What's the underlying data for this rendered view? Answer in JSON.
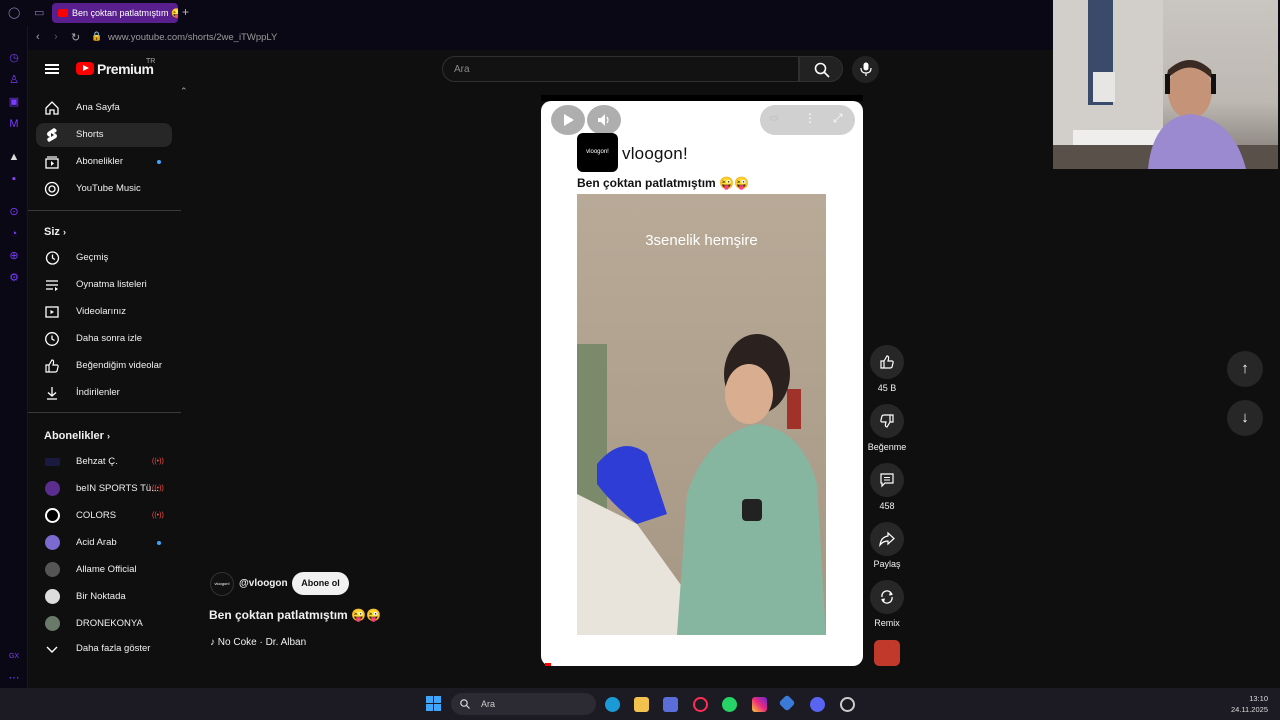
{
  "browser": {
    "tab_title": "Ben çoktan patlatmıştım 😜",
    "new_tab": "+",
    "url": "www.youtube.com/shorts/2we_iTWppLY",
    "sidebar_bottom": "GX"
  },
  "header": {
    "logo_text": "Premium",
    "logo_region": "TR",
    "search_placeholder": "Ara"
  },
  "sidebar": {
    "main": [
      {
        "label": "Ana Sayfa",
        "icon": "home-icon"
      },
      {
        "label": "Shorts",
        "icon": "shorts-icon",
        "active": true
      },
      {
        "label": "Abonelikler",
        "icon": "subscriptions-icon"
      },
      {
        "label": "YouTube Music",
        "icon": "youtube-music-icon"
      }
    ],
    "you_heading": "Siz",
    "you": [
      {
        "label": "Geçmiş",
        "icon": "history-icon"
      },
      {
        "label": "Oynatma listeleri",
        "icon": "playlist-icon"
      },
      {
        "label": "Videolarınız",
        "icon": "your-videos-icon"
      },
      {
        "label": "Daha sonra izle",
        "icon": "watch-later-icon"
      },
      {
        "label": "Beğendiğim videolar",
        "icon": "liked-icon"
      },
      {
        "label": "İndirilenler",
        "icon": "download-icon"
      }
    ],
    "subs_heading": "Abonelikler",
    "subs": [
      {
        "label": "Behzat Ç.",
        "live": "((•))"
      },
      {
        "label": "beIN SPORTS Tü...",
        "live": "((•))"
      },
      {
        "label": "COLORS",
        "live": "((•))"
      },
      {
        "label": "Acid Arab"
      },
      {
        "label": "Allame Official"
      },
      {
        "label": "Bir Noktada"
      },
      {
        "label": "DRONEKONYA"
      }
    ],
    "show_more": "Daha fazla göster"
  },
  "short": {
    "brand_logo": "vloogon!",
    "brand_name": "vloogon!",
    "caption": "Ben çoktan patlatmıştım 😜😜",
    "overlay_text": "3senelik hemşire",
    "progress": 0.02
  },
  "actions": {
    "likes": "45 B",
    "dislike": "Beğenme",
    "comments": "458",
    "share": "Paylaş",
    "remix": "Remix"
  },
  "info": {
    "channel": "@vloogon",
    "subscribe": "Abone ol",
    "title": "Ben çoktan patlatmıştım 😜😜",
    "music": "No Coke · Dr. Alban"
  },
  "taskbar": {
    "search": "Ara",
    "time": "13:10",
    "date": "24.11.2025"
  },
  "colors": {
    "accent": "#ff0000",
    "gx_accent": "#7a3cff",
    "background": "#0f0f0f"
  }
}
